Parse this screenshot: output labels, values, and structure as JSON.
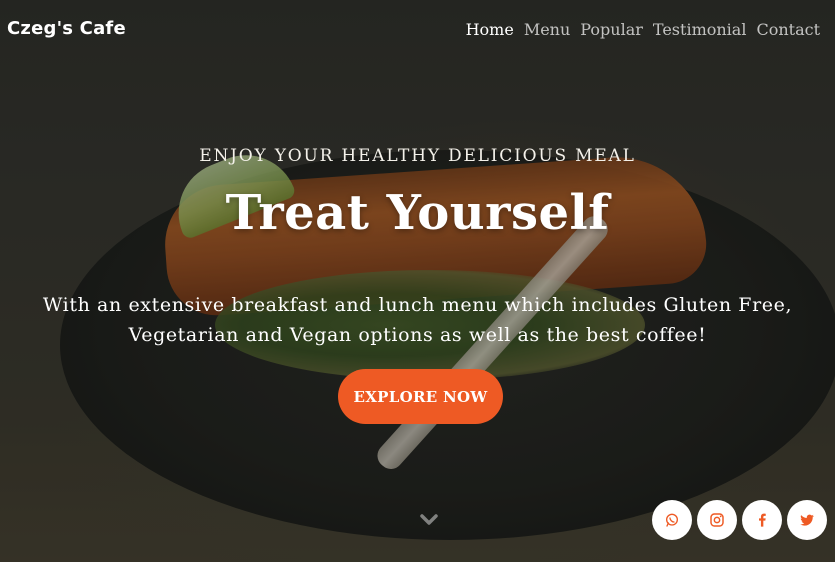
{
  "brand": {
    "name": "Czeg's Cafe"
  },
  "nav": {
    "items": [
      {
        "label": "Home",
        "active": true
      },
      {
        "label": "Menu",
        "active": false
      },
      {
        "label": "Popular",
        "active": false
      },
      {
        "label": "Testimonial",
        "active": false
      },
      {
        "label": "Contact",
        "active": false
      }
    ]
  },
  "hero": {
    "kicker": "ENJOY YOUR HEALTHY DELICIOUS MEAL",
    "title": "Treat Yourself",
    "lead": "With an extensive breakfast and lunch menu which includes Gluten Free, Vegetarian and Vegan options as well as the best coffee!",
    "cta_label": "EXPLORE NOW"
  },
  "scroll_icon": "chevron-down-icon",
  "social": [
    {
      "icon": "whatsapp-icon"
    },
    {
      "icon": "instagram-icon"
    },
    {
      "icon": "facebook-icon"
    },
    {
      "icon": "twitter-icon"
    }
  ],
  "colors": {
    "accent": "#ee5a24",
    "text": "#ffffff"
  }
}
